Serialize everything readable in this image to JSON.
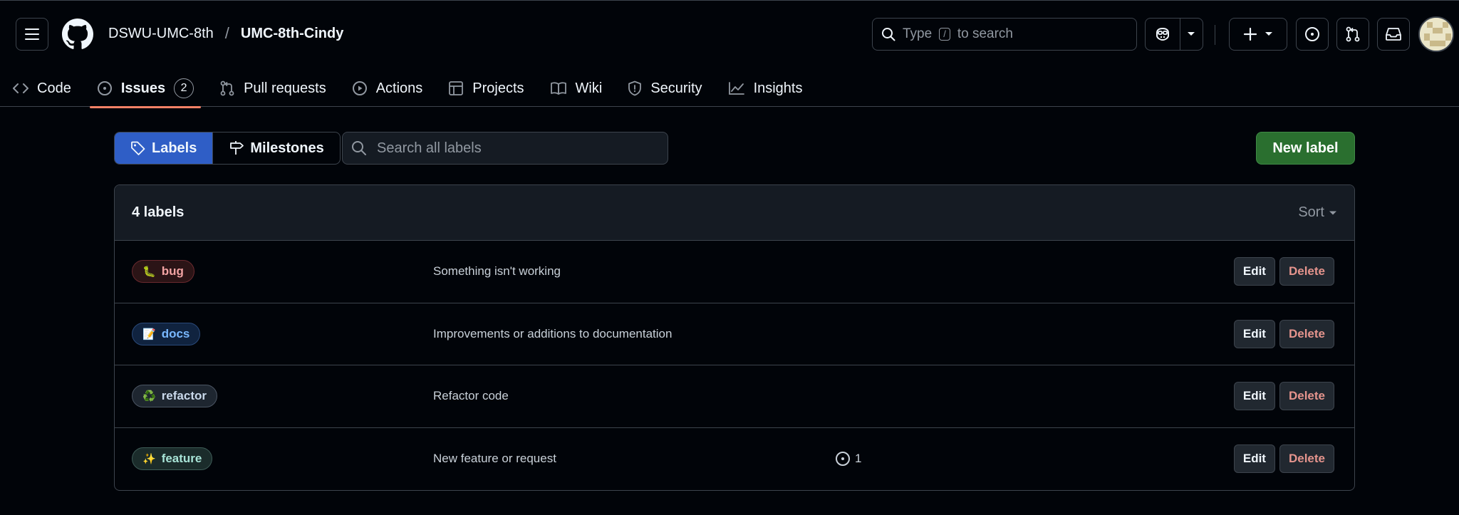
{
  "header": {
    "owner": "DSWU-UMC-8th",
    "separator": "/",
    "repo": "UMC-8th-Cindy",
    "search_prefix": "Type",
    "search_key": "/",
    "search_suffix": "to search"
  },
  "repo_nav": {
    "code": "Code",
    "issues": "Issues",
    "issues_count": "2",
    "pulls": "Pull requests",
    "actions": "Actions",
    "projects": "Projects",
    "wiki": "Wiki",
    "security": "Security",
    "insights": "Insights"
  },
  "subnav": {
    "labels": "Labels",
    "milestones": "Milestones",
    "search_placeholder": "Search all labels",
    "new_label": "New label"
  },
  "labels_box": {
    "title": "4 labels",
    "sort": "Sort",
    "edit": "Edit",
    "delete": "Delete",
    "rows": [
      {
        "emoji": "🐛",
        "name": "bug",
        "description": "Something isn't working",
        "issues": "",
        "bg": "#2b1416",
        "border": "#6b2a2f",
        "color": "#f2a3a3"
      },
      {
        "emoji": "📝",
        "name": "docs",
        "description": "Improvements or additions to documentation",
        "issues": "",
        "bg": "#10233f",
        "border": "#2a4a7a",
        "color": "#79b8ff"
      },
      {
        "emoji": "♻️",
        "name": "refactor",
        "description": "Refactor code",
        "issues": "",
        "bg": "#1e2630",
        "border": "#4b5563",
        "color": "#c9d8ea"
      },
      {
        "emoji": "✨",
        "name": "feature",
        "description": "New feature or request",
        "issues": "1",
        "bg": "#1b2c2b",
        "border": "#3e5c57",
        "color": "#a7e3d6"
      }
    ]
  }
}
